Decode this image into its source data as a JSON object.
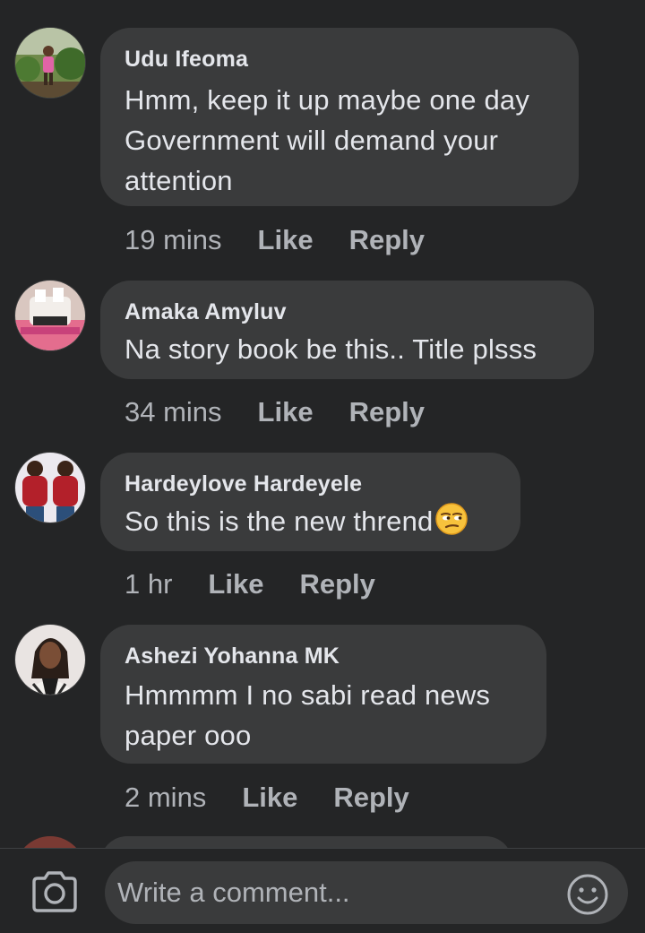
{
  "comments": [
    {
      "author": "Udu Ifeoma",
      "lines": [
        "Hmm, keep it up maybe one day",
        "Government will demand your",
        "attention"
      ],
      "time": "19 mins",
      "like": "Like",
      "reply": "Reply"
    },
    {
      "author": "Amaka Amyluv",
      "lines": [
        "Na story book be this.. Title plsss"
      ],
      "time": "34 mins",
      "like": "Like",
      "reply": "Reply"
    },
    {
      "author": "Hardeylove Hardeyele",
      "lines": [
        "So this is the new thrend"
      ],
      "emoji": "unamused-face-icon",
      "time": "1 hr",
      "like": "Like",
      "reply": "Reply"
    },
    {
      "author": "Ashezi Yohanna MK",
      "lines": [
        "Hmmmm I no sabi read news",
        "paper ooo"
      ],
      "time": "2 mins",
      "like": "Like",
      "reply": "Reply"
    }
  ],
  "composer": {
    "placeholder": "Write a comment...",
    "camera_icon": "camera-icon",
    "emoji_icon": "smiley-face-icon"
  },
  "colors": {
    "background": "#242526",
    "bubble": "#3a3b3c",
    "text": "#e4e6eb",
    "muted": "#b0b3b8"
  }
}
